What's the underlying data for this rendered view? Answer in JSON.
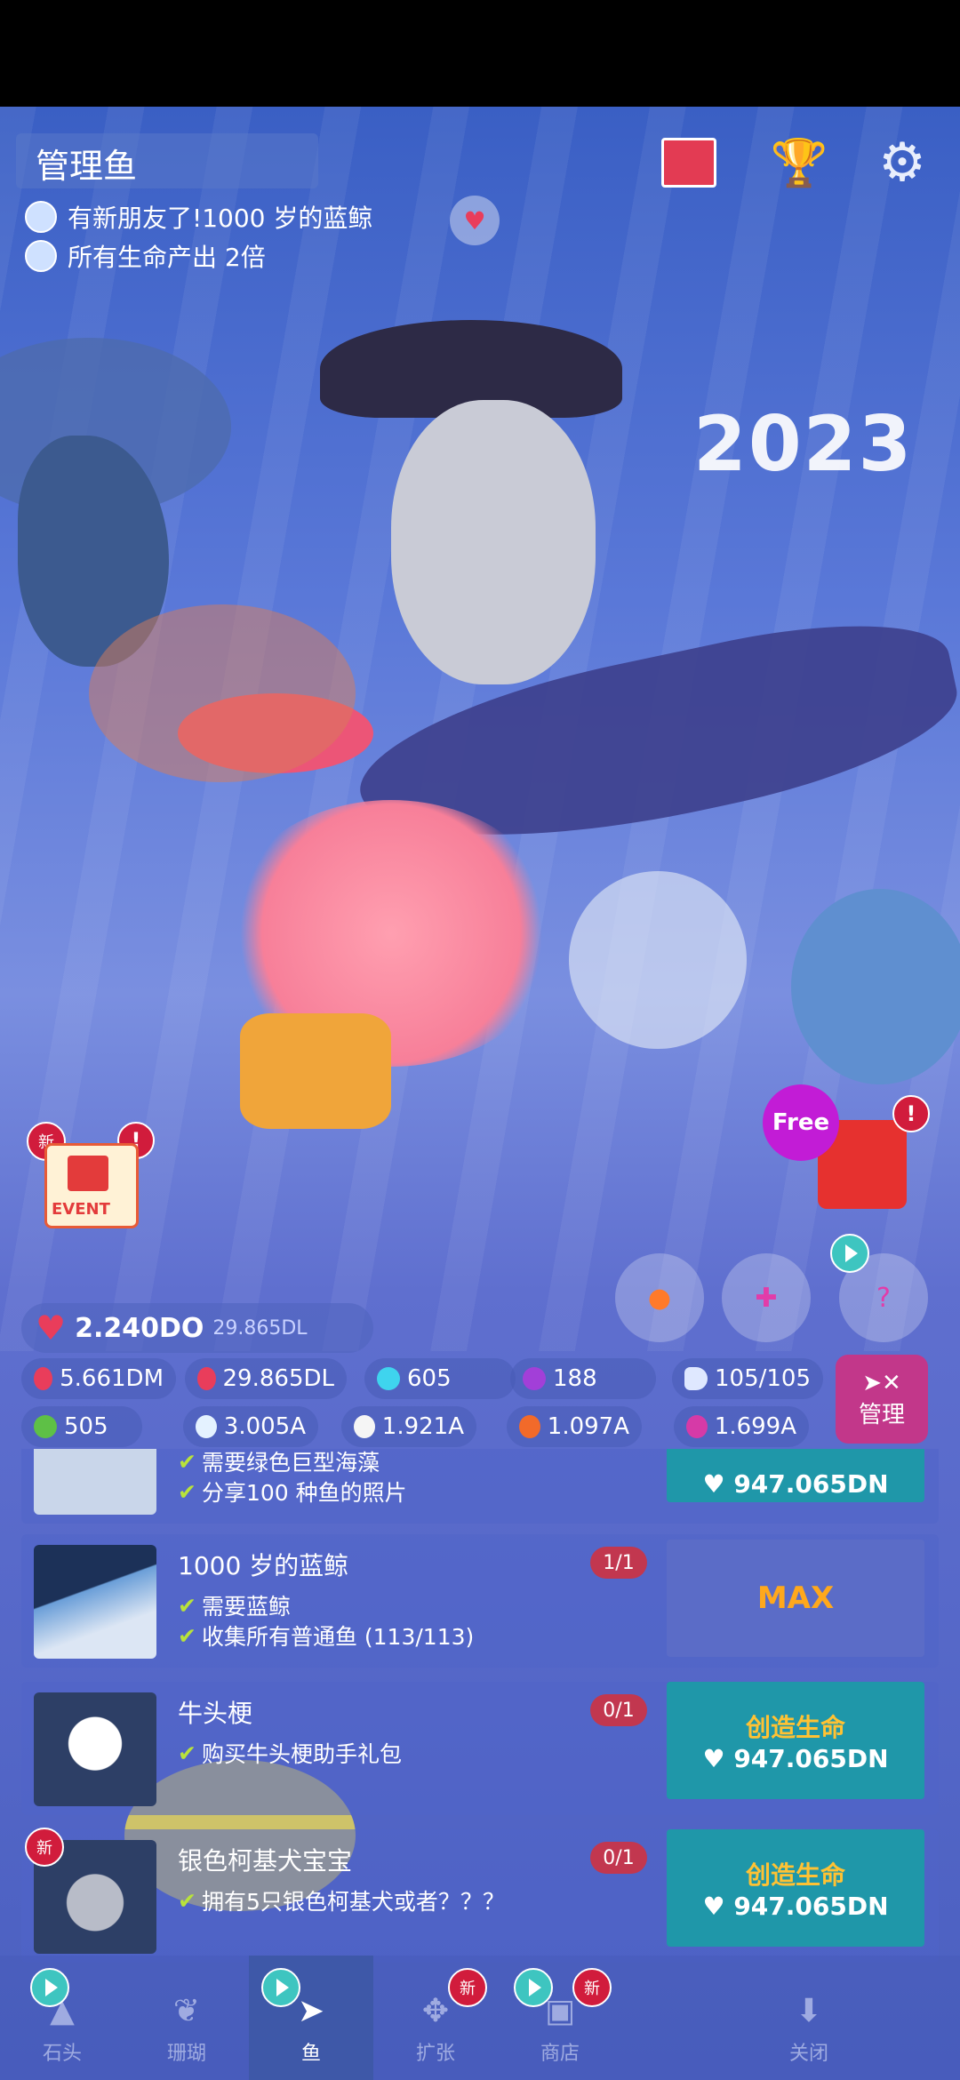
{
  "header": {
    "title": "管理鱼",
    "notices": [
      "有新朋友了!1000 岁的蓝鲸",
      "所有生命产出 2倍"
    ]
  },
  "scene": {
    "year_text": "2023",
    "free_label": "Free",
    "event_label": "EVENT",
    "new_label": "新",
    "alert_label": "!",
    "mystery_label": "?"
  },
  "stats": {
    "hearts_total": "2.240DO",
    "hearts_rate": "29.865DL",
    "tap_value": "5.661DM",
    "heart_rate_1": "29.865DL",
    "gems": "605",
    "pearls": "188",
    "fish_count": "105/105",
    "leaf": "505",
    "ice": "3.005A",
    "shell": "1.921A",
    "crab": "1.097A",
    "seahorse": "1.699A",
    "manage_label": "管理"
  },
  "fish_list": [
    {
      "name": "",
      "count": "",
      "reqs": [
        "需要绿色巨型海藻",
        "分享100 种鱼的照片"
      ],
      "action_title": "",
      "action_cost": "947.065DN"
    },
    {
      "name": "1000 岁的蓝鲸",
      "count": "1/1",
      "reqs": [
        "需要蓝鲸",
        "收集所有普通鱼 (113/113)"
      ],
      "action_max": "MAX"
    },
    {
      "name": "牛头梗",
      "count": "0/1",
      "reqs": [
        "购买牛头梗助手礼包"
      ],
      "action_title": "创造生命",
      "action_cost": "947.065DN"
    },
    {
      "name": "银色柯基犬宝宝",
      "count": "0/1",
      "reqs": [
        "拥有5只银色柯基犬或者？？？"
      ],
      "action_title": "创造生命",
      "action_cost": "947.065DN"
    }
  ],
  "nav": [
    {
      "label": "石头",
      "icon": "rock-icon"
    },
    {
      "label": "珊瑚",
      "icon": "coral-icon"
    },
    {
      "label": "鱼",
      "icon": "fish-icon"
    },
    {
      "label": "扩张",
      "icon": "expand-icon"
    },
    {
      "label": "商店",
      "icon": "shop-icon"
    },
    {
      "label": "",
      "icon": "blank"
    },
    {
      "label": "关闭",
      "icon": "close-icon"
    }
  ],
  "colors": {
    "create_button": "#1f97a9",
    "max_button": "#5b6cc7",
    "badge_red": "#d11c3c",
    "accent_gold": "#ffc233"
  }
}
